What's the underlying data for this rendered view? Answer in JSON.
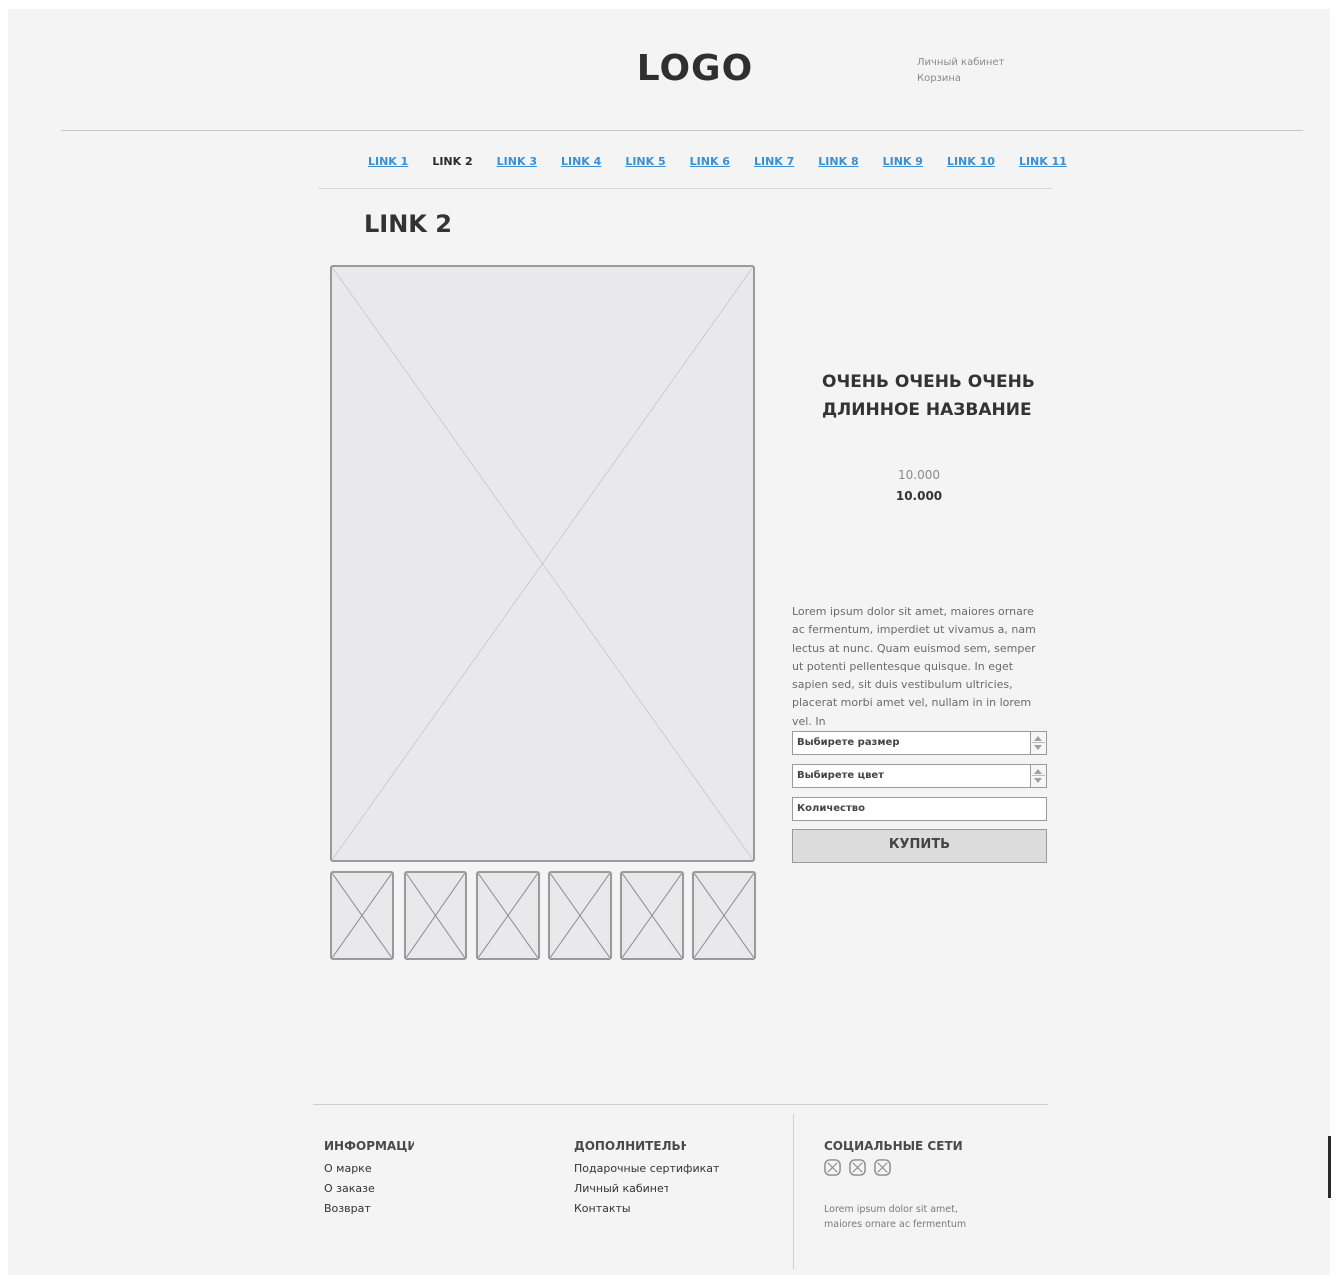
{
  "header": {
    "logo": "LOGO",
    "account_links": [
      "Личный кабинет",
      "Корзина"
    ]
  },
  "nav": {
    "links": [
      "LINK 1",
      "LINK 2",
      "LINK 3",
      "LINK 4",
      "LINK 5",
      "LINK 6",
      "LINK 7",
      "LINK 8",
      "LINK 9",
      "LINK 10",
      "LINK 11"
    ],
    "active": "LINK 2"
  },
  "page_title": "LINK 2",
  "product": {
    "title_line1": "ОЧЕНЬ ОЧЕНЬ ОЧЕНЬ",
    "title_line2": "ДЛИННОЕ НАЗВАНИЕ",
    "price_old": "10.000",
    "price": "10.000",
    "description": "Lorem ipsum dolor sit amet, maiores ornare ac fermentum, imperdiet ut vivamus a, nam lectus at nunc. Quam euismod sem, semper ut potenti pellentesque quisque. In eget sapien sed, sit duis vestibulum ultricies, placerat morbi amet vel, nullam in in lorem vel. In",
    "size_placeholder": "Выбирете размер",
    "color_placeholder": "Выбирете цвет",
    "quantity_placeholder": "Количество",
    "buy_label": "КУПИТЬ"
  },
  "footer": {
    "info": {
      "heading": "ИНФОРМАЦИЯ",
      "items": [
        "О марке",
        "О заказе",
        "Возврат"
      ]
    },
    "extra": {
      "heading": "ДОПОЛНИТЕЛЬНО",
      "items": [
        "Подарочные сертификаты",
        "Личный кабинет",
        "Контакты"
      ]
    },
    "social": {
      "heading": "СОЦИАЛЬНЫЕ СЕТИ",
      "icons": [
        "social-icon",
        "social-icon",
        "social-icon"
      ],
      "note": "Lorem ipsum dolor sit amet, maiores ornare ac fermentum"
    }
  }
}
